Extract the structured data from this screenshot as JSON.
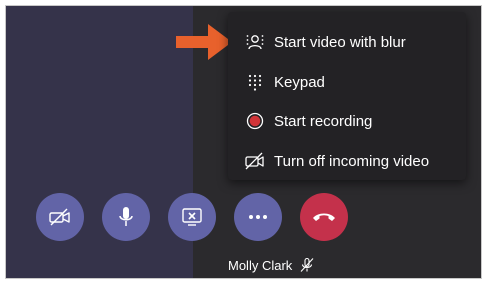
{
  "menu": {
    "items": [
      {
        "label": "Start video with blur",
        "icon": "blur-background-icon"
      },
      {
        "label": "Keypad",
        "icon": "keypad-icon"
      },
      {
        "label": "Start recording",
        "icon": "record-icon"
      },
      {
        "label": "Turn off incoming video",
        "icon": "video-off-icon"
      }
    ]
  },
  "controls": [
    {
      "name": "camera-toggle",
      "icon": "video-off-icon",
      "color": "#6264a7"
    },
    {
      "name": "microphone",
      "icon": "microphone-icon",
      "color": "#6264a7"
    },
    {
      "name": "share-screen",
      "icon": "stop-sharing-icon",
      "color": "#6264a7"
    },
    {
      "name": "more-actions",
      "icon": "more-icon",
      "color": "#6264a7"
    },
    {
      "name": "hang-up",
      "icon": "hang-up-icon",
      "color": "#c4314b"
    }
  ],
  "participant": {
    "name": "Molly Clark",
    "status_icon": "muted-mic-icon"
  },
  "annotation": {
    "icon": "arrow-icon",
    "color": "#e8612c"
  },
  "colors": {
    "accent": "#6264a7",
    "danger": "#c4314b",
    "record": "#d13438",
    "menu_background": "#232225",
    "left_pane": "#35334a"
  }
}
